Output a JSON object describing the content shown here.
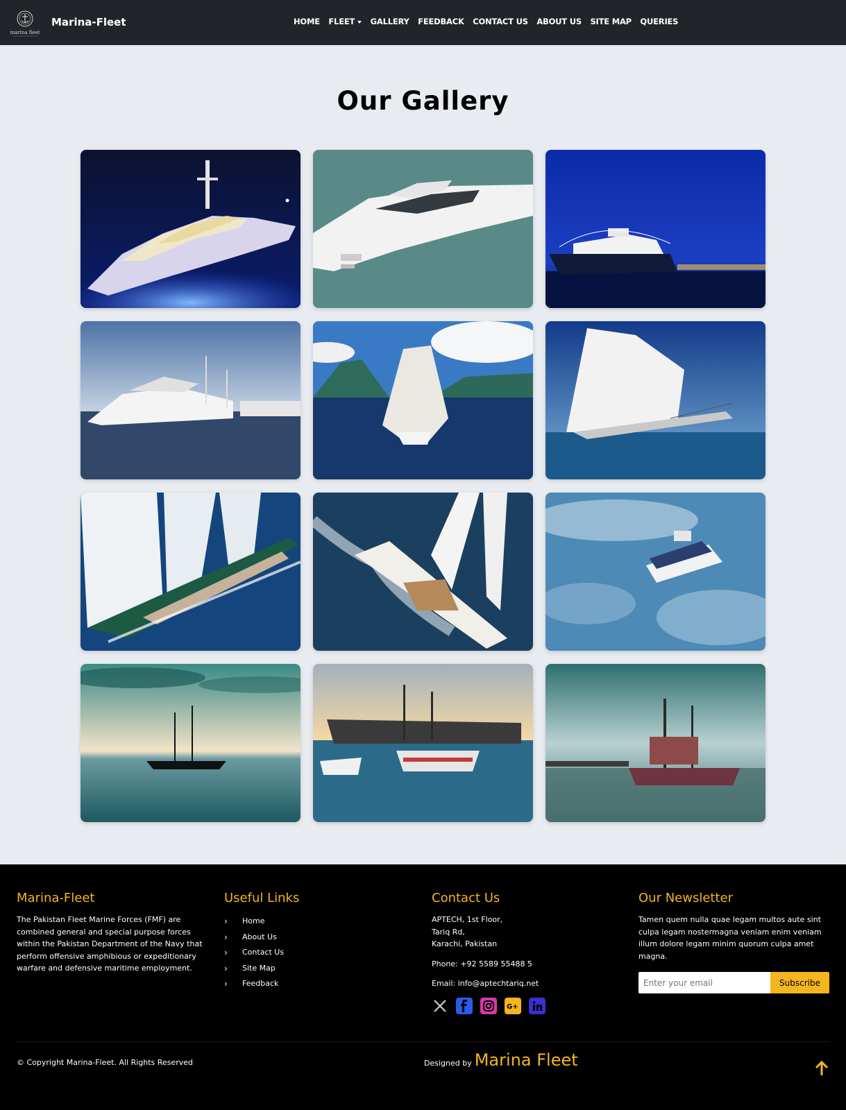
{
  "navbar": {
    "logo_text": "marina fleet",
    "brand": "Marina-Fleet",
    "links": [
      {
        "label": "HOME"
      },
      {
        "label": "FLEET",
        "dropdown": true
      },
      {
        "label": "GALLERY"
      },
      {
        "label": "FEEDBACK"
      },
      {
        "label": "CONTACT US"
      },
      {
        "label": "ABOUT US"
      },
      {
        "label": "SITE MAP"
      },
      {
        "label": "QUERIES"
      }
    ]
  },
  "main": {
    "title": "Our Gallery",
    "images": [
      "superyacht-night",
      "white-yacht-aerial",
      "ship-harbor-night",
      "yacht-marina",
      "tall-ship-mountains",
      "tall-ship-waves",
      "green-sailing-yacht",
      "sailing-yacht-aerial",
      "ferry-rough-water",
      "sailboat-sunset",
      "fishing-harbor",
      "fishing-boats-dock"
    ]
  },
  "footer": {
    "about": {
      "heading": "Marina-Fleet",
      "text": "The Pakistan Fleet Marine Forces (FMF) are combined general and special purpose forces within the Pakistan Department of the Navy that perform offensive amphibious or expeditionary warfare and defensive maritime employment."
    },
    "links": {
      "heading": "Useful Links",
      "items": [
        "Home",
        "About Us",
        "Contact Us",
        "Site Map",
        "Feedback"
      ]
    },
    "contact": {
      "heading": "Contact Us",
      "address_line1": "APTECH, 1st Floor,",
      "address_line2": "Tariq Rd,",
      "address_line3": "Karachi, Pakistan",
      "phone": "Phone: +92 5589 55488 5",
      "email": "Email: info@aptechtariq.net",
      "socials": [
        "x-icon",
        "facebook-icon",
        "instagram-icon",
        "google-plus-icon",
        "linkedin-icon"
      ]
    },
    "newsletter": {
      "heading": "Our Newsletter",
      "text": "Tamen quem nulla quae legam multos aute sint culpa legam nostermagna veniam enim veniam illum dolore legam minim quorum culpa amet magna.",
      "placeholder": "Enter your email",
      "button": "Subscribe"
    },
    "copyright": "© Copyright Marina-Fleet. All Rights Reserved",
    "designed_by": "Designed by",
    "designed_brand": "Marina Fleet"
  },
  "colors": {
    "navbar_bg": "#212529",
    "page_bg": "#e8ebef",
    "footer_bg": "#000000",
    "accent": "#f5b51e"
  }
}
